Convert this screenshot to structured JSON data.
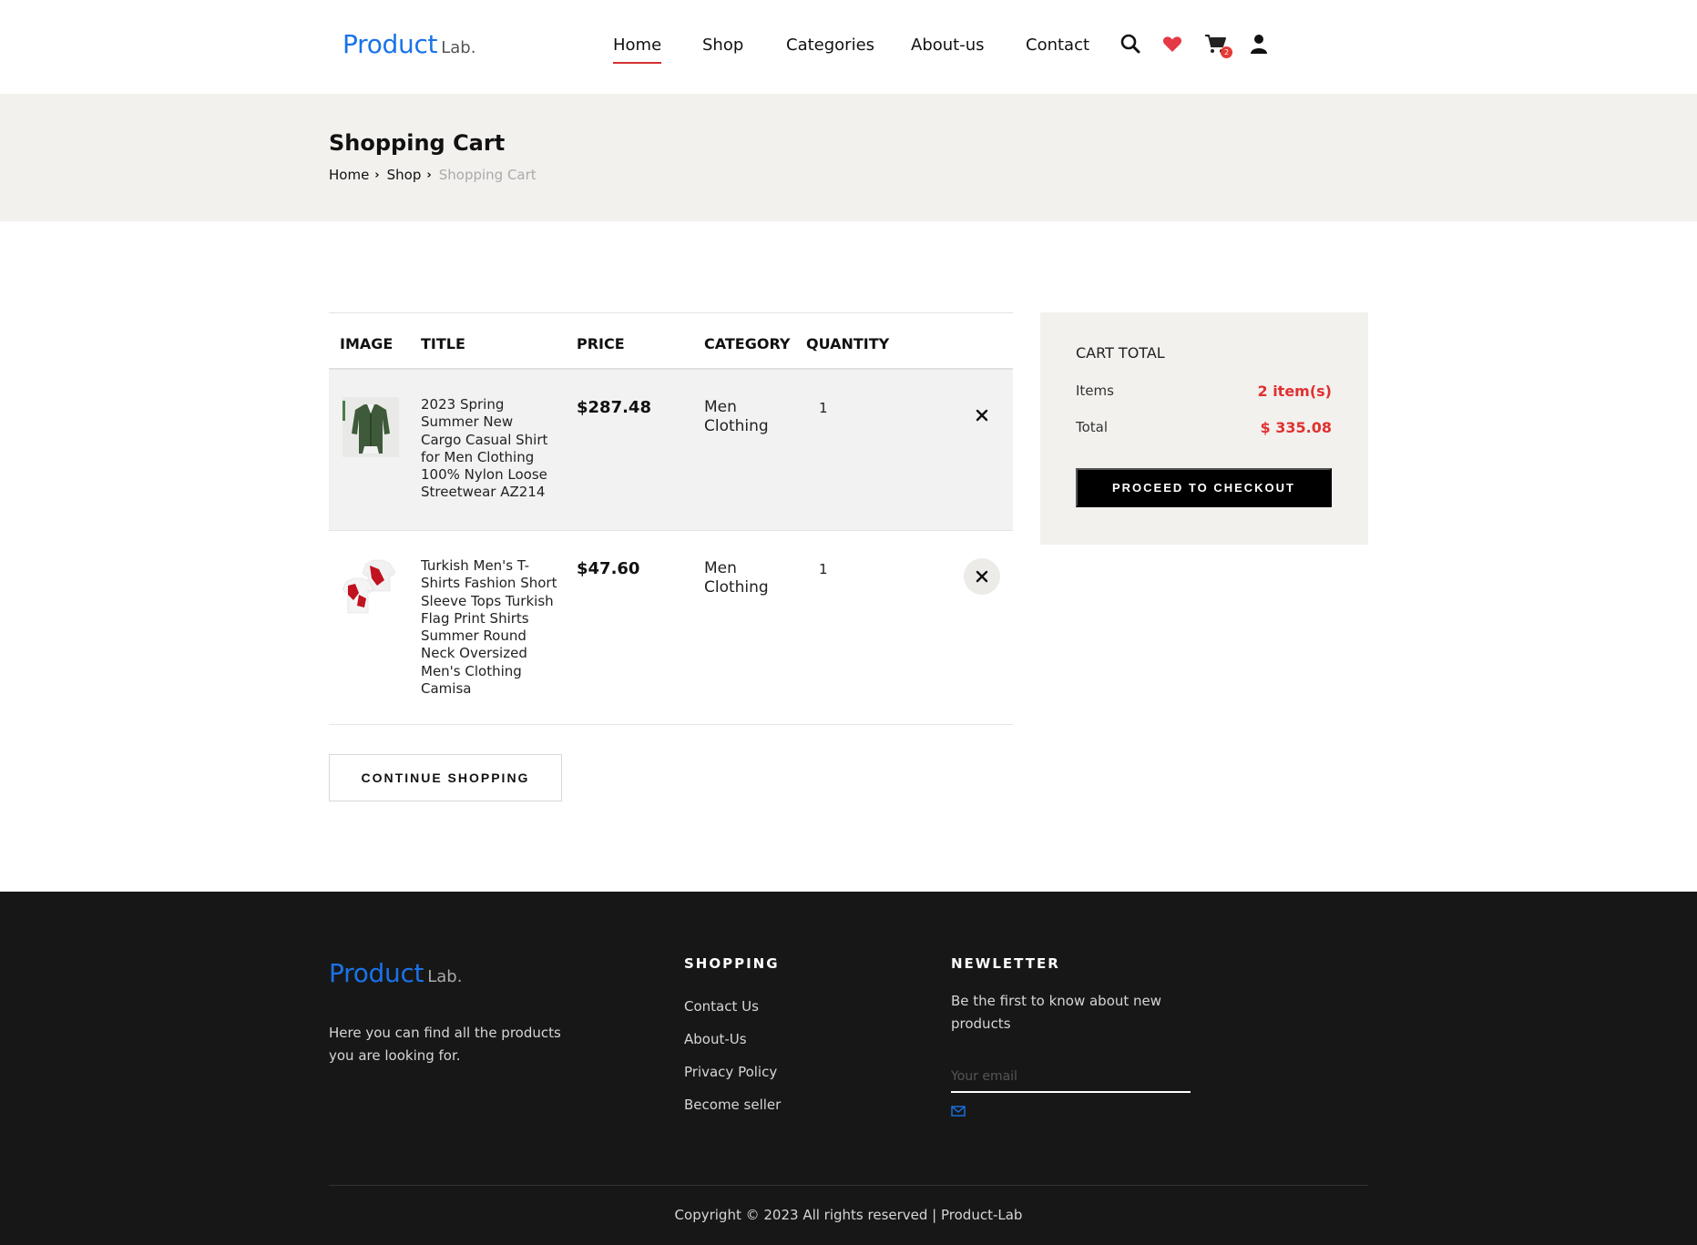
{
  "brand": {
    "name": "Product",
    "suffix": "Lab."
  },
  "nav": {
    "items": [
      {
        "label": "Home",
        "active": true
      },
      {
        "label": "Shop"
      },
      {
        "label": "Categories"
      },
      {
        "label": "About-us"
      },
      {
        "label": "Contact"
      }
    ],
    "icons": [
      "search-icon",
      "heart-icon",
      "cart-icon",
      "user-icon"
    ],
    "cart_count": "2"
  },
  "banner": {
    "title": "Shopping Cart",
    "breadcrumb": [
      "Home",
      "Shop",
      "Shopping Cart"
    ]
  },
  "cart": {
    "columns": [
      "IMAGE",
      "TITLE",
      "PRICE",
      "CATEGORY",
      "QUANTITY"
    ],
    "items": [
      {
        "title": "2023 Spring Summer New Cargo Casual Shirt for Men Clothing 100% Nylon Loose Streetwear AZ214",
        "price": "$287.48",
        "category": "Men Clothing",
        "quantity": "1"
      },
      {
        "title": "Turkish Men's T-Shirts Fashion Short Sleeve Tops Turkish Flag Print Shirts Summer Round Neck Oversized Men's Clothing Camisa",
        "price": "$47.60",
        "category": "Men Clothing",
        "quantity": "1"
      }
    ],
    "continue_label": "CONTINUE SHOPPING"
  },
  "cart_total": {
    "title": "CART TOTAL",
    "items_label": "Items",
    "items_value": "2 item(s)",
    "total_label": "Total",
    "total_value": "$ 335.08",
    "checkout_label": "PROCEED TO CHECKOUT"
  },
  "footer": {
    "description": "Here you can find all the products you are looking for.",
    "shopping_heading": "SHOPPING",
    "links": [
      "Contact Us",
      "About-Us",
      "Privacy Policy",
      "Become seller"
    ],
    "newsletter_heading": "NEWLETTER",
    "newsletter_desc": "Be the first to know about new products",
    "email_placeholder": "Your email",
    "copyright": "Copyright © 2023 All rights reserved | Product-Lab"
  },
  "colors": {
    "brand_blue": "#1a73e8",
    "accent_red": "#e03131",
    "banner_bg": "#f2f1ee",
    "footer_bg": "#171717"
  }
}
